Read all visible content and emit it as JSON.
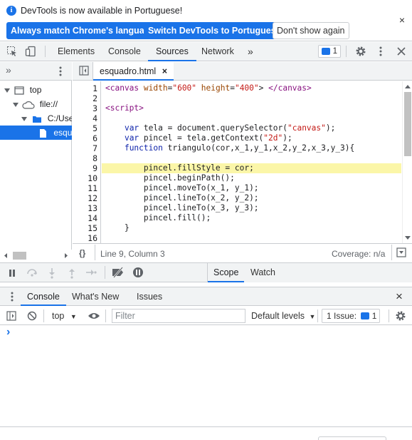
{
  "infobar": {
    "message": "DevTools is now available in Portuguese!",
    "btn_match": "Always match Chrome's language",
    "btn_switch": "Switch DevTools to Portuguese",
    "btn_dont_show": "Don't show again",
    "close": "×"
  },
  "tabs": {
    "elements": "Elements",
    "console": "Console",
    "sources": "Sources",
    "network": "Network",
    "more": "»",
    "issues_count": "1"
  },
  "navigator": {
    "more": "»",
    "tree": [
      {
        "label": "top"
      },
      {
        "label": "file://"
      },
      {
        "label": "C:/User"
      },
      {
        "label": "esqua"
      }
    ]
  },
  "editor": {
    "file_tab": "esquadro.html",
    "file_close": "×",
    "lines": [
      {
        "n": "1",
        "text": "<canvas width=\"600\" height=\"400\"> </canvas>"
      },
      {
        "n": "2",
        "text": ""
      },
      {
        "n": "3",
        "text": "<script>"
      },
      {
        "n": "4",
        "text": ""
      },
      {
        "n": "5",
        "text": "    var tela = document.querySelector(\"canvas\");"
      },
      {
        "n": "6",
        "text": "    var pincel = tela.getContext(\"2d\");"
      },
      {
        "n": "7",
        "text": "    function triangulo(cor,x_1,y_1,x_2,y_2,x_3,y_3){"
      },
      {
        "n": "8",
        "text": ""
      },
      {
        "n": "9",
        "text": "        pincel.fillStyle = cor;"
      },
      {
        "n": "10",
        "text": "        pincel.beginPath();"
      },
      {
        "n": "11",
        "text": "        pincel.moveTo(x_1, y_1);"
      },
      {
        "n": "12",
        "text": "        pincel.lineTo(x_2, y_2);"
      },
      {
        "n": "13",
        "text": "        pincel.lineTo(x_3, y_3);"
      },
      {
        "n": "14",
        "text": "        pincel.fill();"
      },
      {
        "n": "15",
        "text": "    }"
      },
      {
        "n": "16",
        "text": ""
      }
    ],
    "highlighted_line": 9
  },
  "status": {
    "braces": "{}",
    "position": "Line 9, Column 3",
    "coverage": "Coverage: n/a"
  },
  "debugger": {
    "scope_tab": "Scope",
    "watch_tab": "Watch"
  },
  "drawer": {
    "tab_console": "Console",
    "tab_whats_new": "What's New",
    "tab_issues": "Issues",
    "close": "×",
    "context": "top",
    "filter_placeholder": "Filter",
    "levels": "Default levels",
    "issues_label": "1 Issue:",
    "issues_count": "1",
    "prompt": "›"
  },
  "colors": {
    "accent": "#1a73e8",
    "highlight": "#fbf6a8",
    "string": "#c41a16",
    "keyword": "#0d22aa",
    "tag": "#881280",
    "attr": "#994500"
  }
}
